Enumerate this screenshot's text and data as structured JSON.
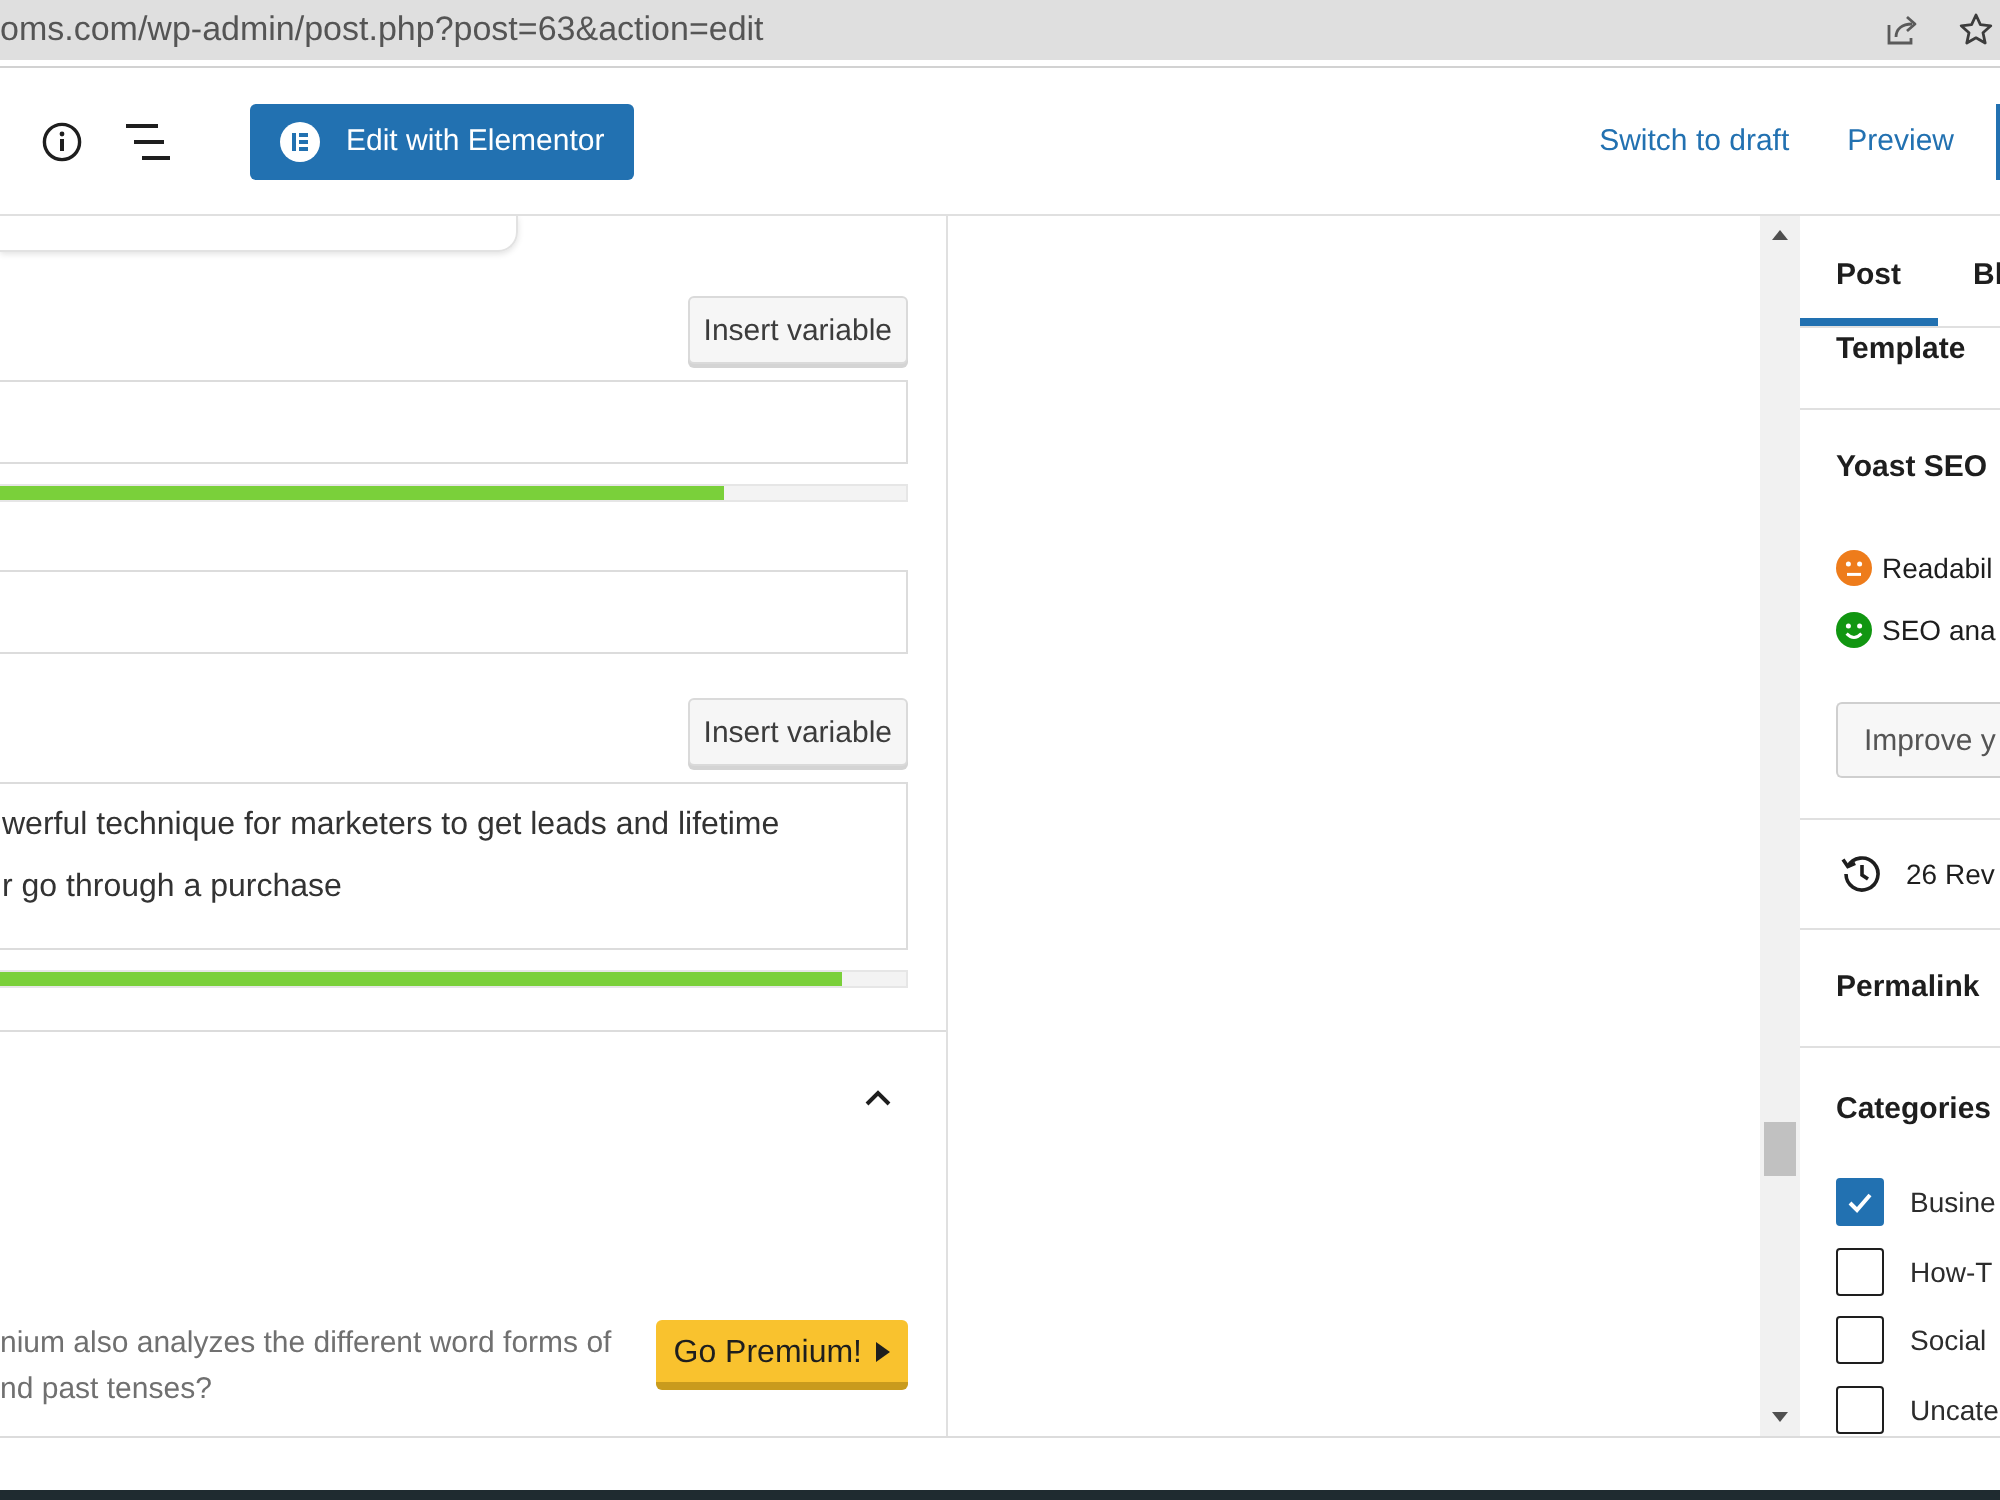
{
  "browser": {
    "url": "oms.com/wp-admin/post.php?post=63&action=edit"
  },
  "header": {
    "elementor_button": "Edit with Elementor",
    "links": [
      "Switch to draft",
      "Preview"
    ]
  },
  "editor_panel": {
    "fields": [
      {
        "kind": "input",
        "insert_button": "Insert variable",
        "level": 0.8
      },
      {
        "kind": "input"
      },
      {
        "kind": "textarea",
        "insert_button": "Insert variable",
        "lines": [
          "werful technique for marketers to get leads and lifetime",
          "r go through a purchase"
        ],
        "level": 0.93
      }
    ],
    "section": {
      "expanded": true,
      "note_lines": [
        "nium also analyzes the different word forms of",
        "nd past tenses?"
      ],
      "premium_button": "Go Premium!"
    }
  },
  "sidebar": {
    "tabs": [
      {
        "label": "Post",
        "selected": true
      },
      {
        "label": "Bl",
        "selected": false
      }
    ],
    "template": "Template",
    "yoast": {
      "title": "Yoast SEO",
      "scores": [
        {
          "kind": "neutral",
          "color": "#ee7c1b",
          "label": "Readabil"
        },
        {
          "kind": "smile",
          "color": "#119611",
          "label": "SEO ana"
        }
      ],
      "button": "Improve y"
    },
    "revisions": "26 Rev",
    "permalink": "Permalink",
    "categories": {
      "title": "Categories",
      "items": [
        {
          "label": "Busine",
          "checked": true
        },
        {
          "label": "How-T",
          "checked": false
        },
        {
          "label": "Social",
          "checked": false
        },
        {
          "label": "Uncate",
          "checked": false
        }
      ]
    }
  }
}
